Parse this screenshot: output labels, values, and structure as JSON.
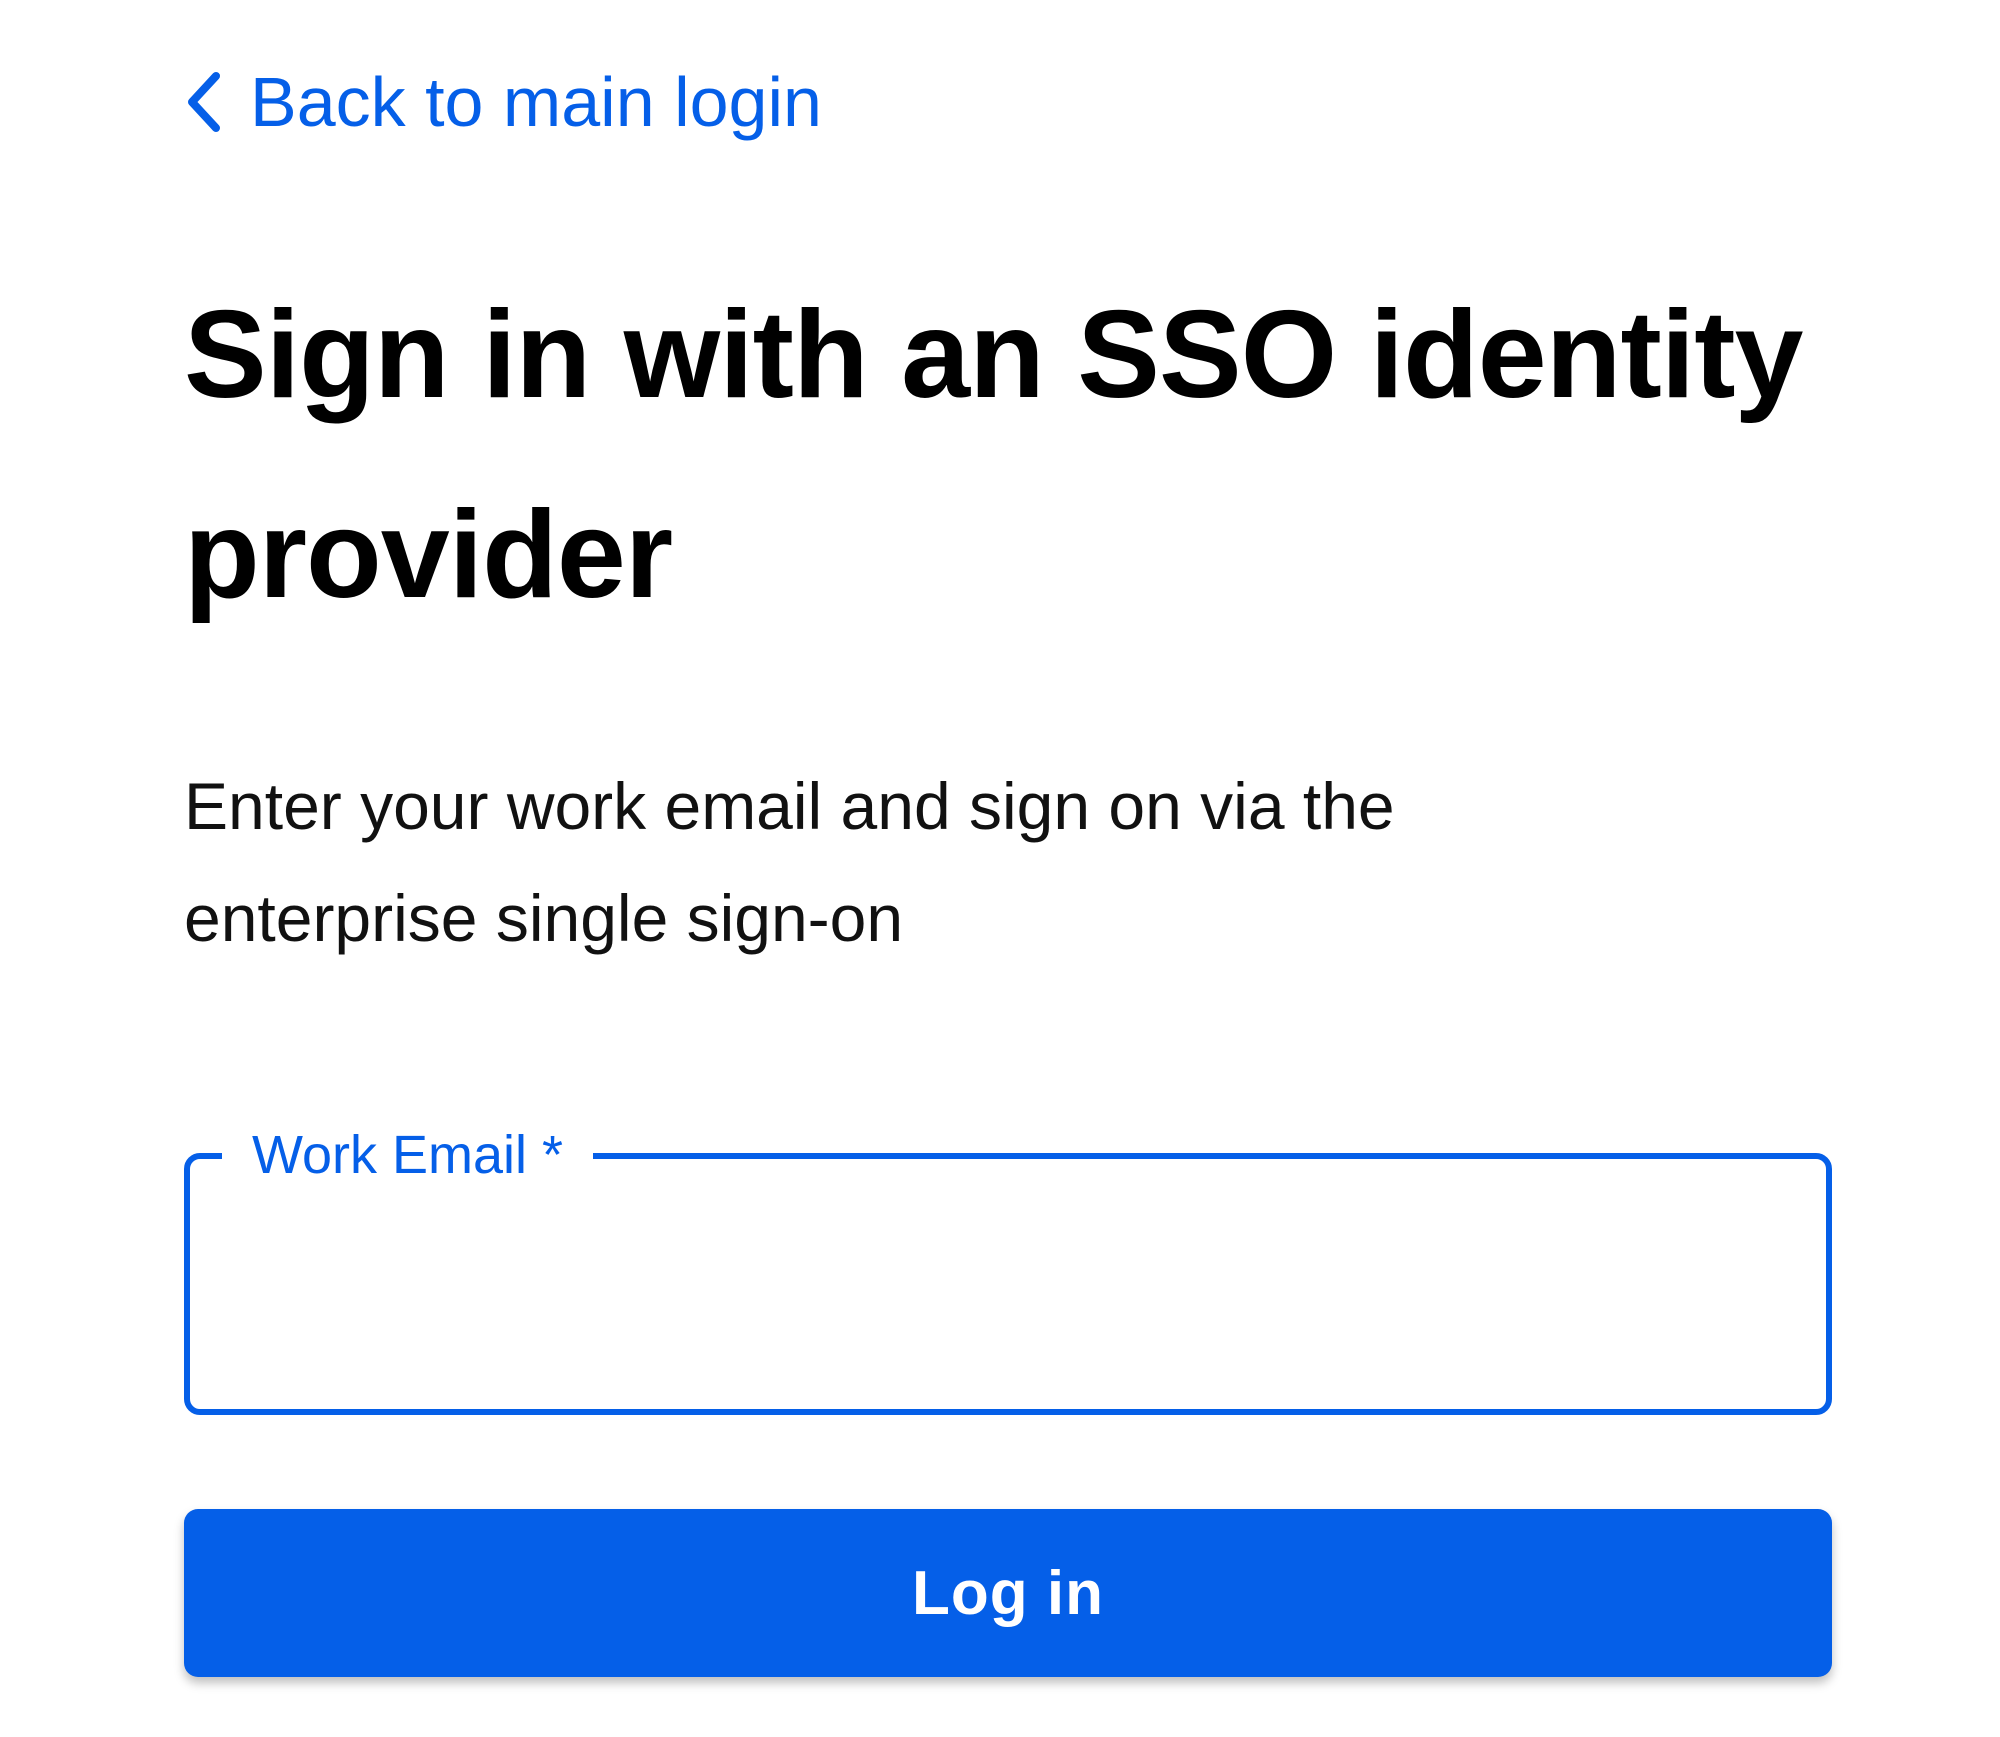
{
  "colors": {
    "accent": "#055FE8",
    "text": "#000000",
    "background": "#FFFFFF",
    "button_text": "#FFFFFF"
  },
  "back_link": {
    "icon": "chevron-left-icon",
    "label": "Back to main login"
  },
  "page": {
    "title": "Sign in with an SSO identity provider",
    "description": "Enter your work email and sign on via the enterprise single sign-on"
  },
  "form": {
    "email_label": "Work Email *",
    "email_value": "",
    "submit_label": "Log in"
  }
}
